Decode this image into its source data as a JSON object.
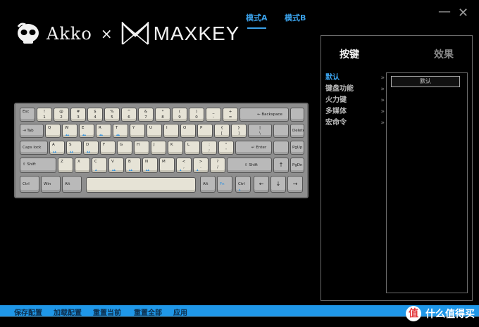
{
  "header": {
    "logo_left": "Akko",
    "logo_times": "×",
    "logo_right": "MAXKEY",
    "mode_tabs": [
      "模式A",
      "模式B"
    ],
    "active_mode": "模式A"
  },
  "window": {
    "minimize": "—",
    "close": "✕"
  },
  "keyboard": {
    "alpha_color": "#e6e3d6",
    "mod_color": "#b9b9b9",
    "case_color": "#8e8e8e",
    "layer_color": "#2a8fe0"
  },
  "keys": {
    "esc": "Esc",
    "n1_top": "!",
    "n1": "1",
    "n2_top": "@",
    "n2": "2",
    "n3_top": "#",
    "n3": "3",
    "n4_top": "$",
    "n4": "4",
    "n5_top": "%",
    "n5": "5",
    "n6_top": "^",
    "n6": "6",
    "n7_top": "&",
    "n7": "7",
    "n8_top": "*",
    "n8": "8",
    "n9_top": "(",
    "n9": "9",
    "n0_top": ")",
    "n0": "0",
    "minus_top": "_",
    "minus": "-",
    "equal_top": "+",
    "equal": "=",
    "backspace": "← Backspace",
    "tab": "⇥ Tab",
    "q": "Q",
    "w": "W",
    "e": "E",
    "r": "R",
    "t": "T",
    "y": "Y",
    "u": "U",
    "i": "I",
    "o": "O",
    "p": "P",
    "lbrace_top": "{",
    "lbrace": "[",
    "rbrace_top": "}",
    "rbrace": "]",
    "pipe_top": "|",
    "pipe": "\\",
    "delete": "Delete",
    "caps": "Caps lock",
    "a": "A",
    "s": "S",
    "d": "D",
    "f": "F",
    "g": "G",
    "h": "H",
    "j": "J",
    "k": "K",
    "l": "L",
    "colon_top": ":",
    "colon": ";",
    "quote_top": "\"",
    "quote": "'",
    "enter": "↵ Enter",
    "pgup": "PgUp",
    "lshift": "⇧ Shift",
    "z": "Z",
    "x": "X",
    "c": "C",
    "v": "V",
    "b": "B",
    "n": "N",
    "m": "M",
    "lt_top": "<",
    "lt": ",",
    "gt_top": ">",
    "gt": ".",
    "qm_top": "?",
    "qm": "/",
    "rshift": "⇧ Shift",
    "up": "↑",
    "pgdn": "PgDn",
    "lctrl": "Ctrl",
    "win": "Win",
    "lalt": "Alt",
    "ralt": "Alt",
    "fn": "Fn",
    "rctrl": "Ctrl",
    "left": "←",
    "down": "↓",
    "right": "→"
  },
  "panel": {
    "tabs": [
      "按键",
      "效果"
    ],
    "items": [
      "默认",
      "键盘功能",
      "火力键",
      "多媒体",
      "宏命令"
    ],
    "chevron": "»",
    "selected_option": "默认"
  },
  "bottom": {
    "items": [
      "保存配置",
      "加载配置",
      "重置当前",
      "重置全部",
      "应用"
    ],
    "watermark_icon": "值",
    "watermark_text": "什么值得买"
  }
}
